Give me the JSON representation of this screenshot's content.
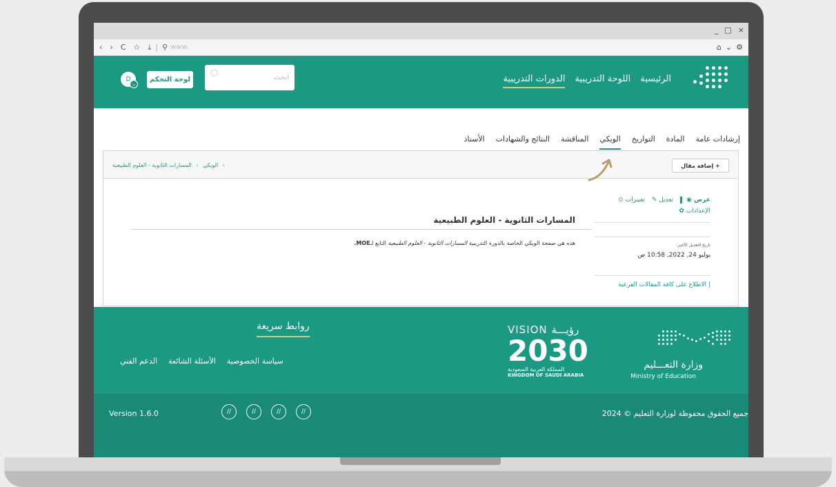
{
  "browser": {
    "window_controls": [
      "_",
      "□",
      "×"
    ],
    "nav_icons": [
      "‹",
      "›",
      "C",
      "☆",
      "⤓"
    ],
    "url_placeholder": "www.",
    "right_icons": [
      "⌂",
      "⌄",
      "⚙"
    ]
  },
  "header": {
    "nav_items": [
      "الرئيسية",
      "اللوحة التدريبية",
      "الدورات التدريبية"
    ],
    "active_nav": "الدورات التدريبية",
    "search_placeholder": "ابحث",
    "dashboard_label": "لوحة التحكم",
    "avatar_initial": "D",
    "accent_color": "#1c9982",
    "underline_color": "#e2c77d"
  },
  "course_tabs": {
    "items": [
      "إرشادات عامة",
      "المادة",
      "التواريخ",
      "الويكي",
      "المناقشة",
      "النتائج والشهادات",
      "الأستاذ"
    ],
    "active": "الويكي"
  },
  "wiki": {
    "add_article": "+ إضافة مقال",
    "breadcrumb": [
      "الويكي",
      "المسارات الثانوية - العلوم الطبيعية"
    ],
    "actions": {
      "view": "عرض",
      "edit": "تعديل",
      "changes": "تغييرات",
      "settings": "الإعدادات"
    },
    "meta_label": "تاريخ التعديل الأخير:",
    "meta_date": "يوليو 24, 2022, 10:58 ص",
    "sub_articles_link": "| الاطلاع على كافة المقالات الفرعية",
    "title": "المسارات الثانوية - العلوم الطبيعية",
    "body_prefix": "هذه هي صفحة الويكي الخاصة بالدورة التدريبية ",
    "body_course": "المسارات الثانوية - العلوم الطبيعية",
    "body_suffix": " التابع لـ",
    "body_org": "MOE."
  },
  "footer": {
    "quick_links_title": "روابط سريعة",
    "quick_links": [
      "سياسة الخصوصية",
      "الأسئلة الشائعة",
      "الدعم الفني"
    ],
    "vision_top": "VISION رؤيـــة",
    "vision_number": "2030",
    "vision_ar": "المملكة العربية السعودية",
    "vision_en": "KINGDOM OF SAUDI ARABIA",
    "moe_ar": "وزارة التعـــليم",
    "moe_en": "Ministry of Education",
    "copyright": "جميع الحقوق محفوظة لوزارة التعليم © 2024",
    "version": "Version 1.6.0",
    "social_icons": [
      "//",
      "//",
      "//",
      "//"
    ]
  }
}
